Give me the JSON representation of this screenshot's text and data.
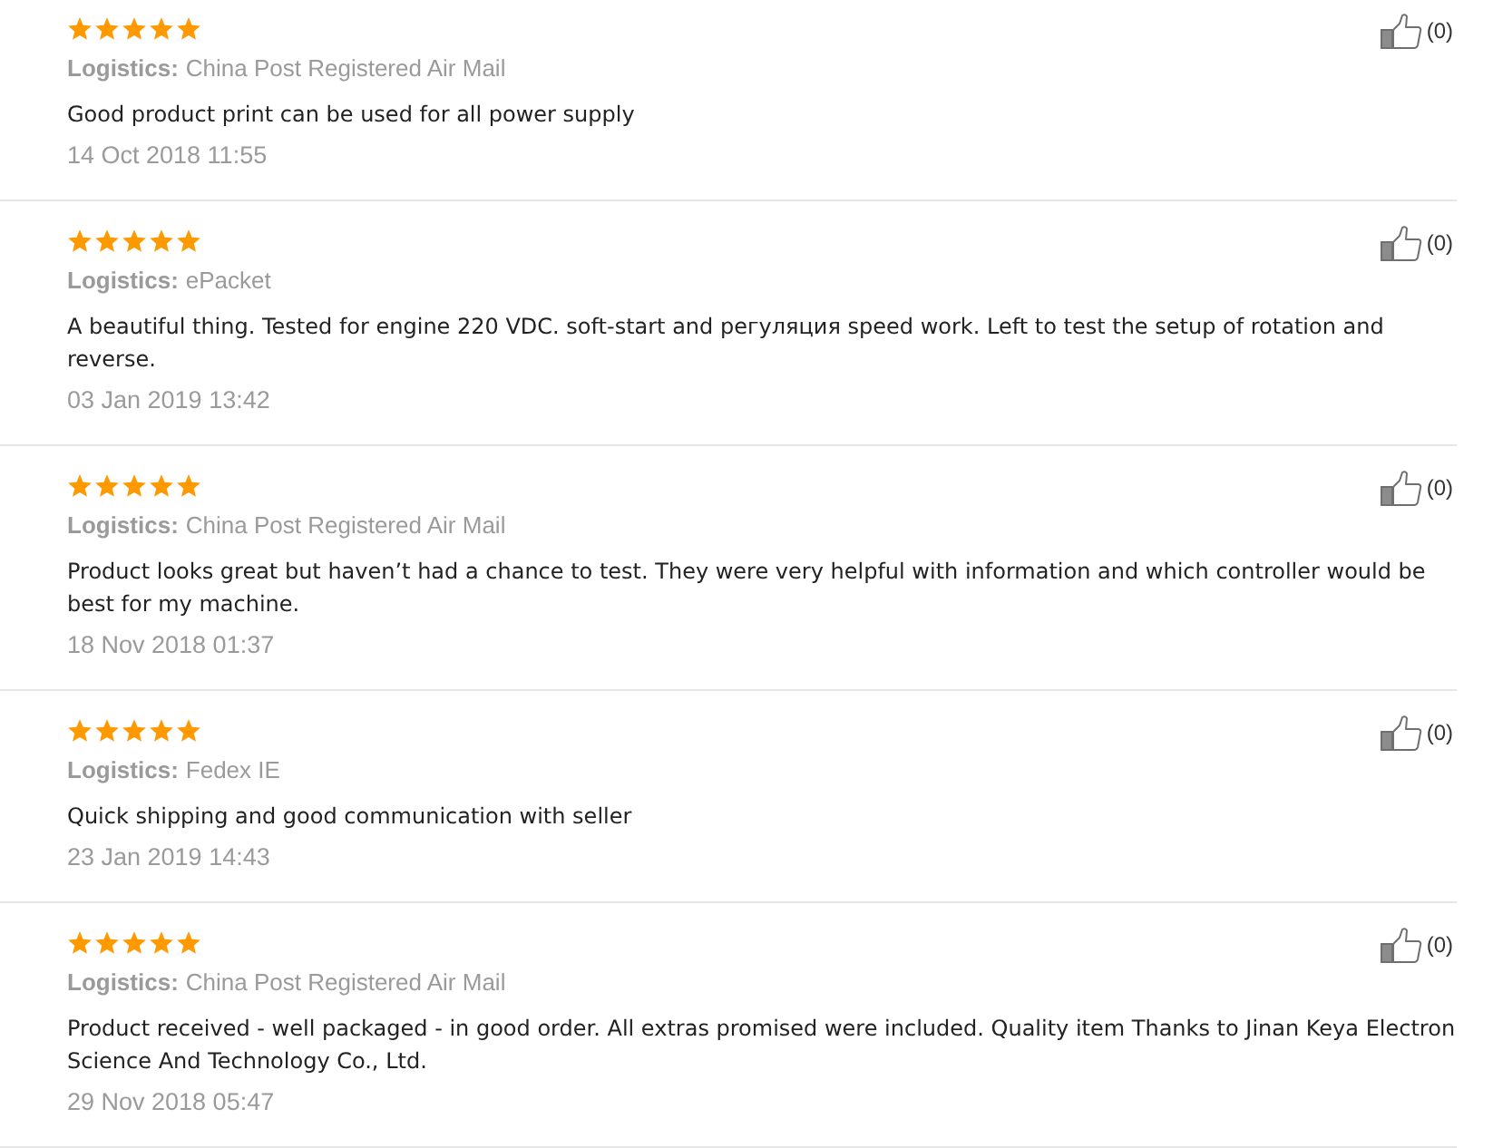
{
  "reviews": [
    {
      "stars": 5,
      "logistics_label": "Logistics:",
      "logistics": "China Post Registered Air Mail",
      "text": "Good product print can be used for all power supply",
      "date": "14 Oct 2018 11:55",
      "helpful_count": "(0)"
    },
    {
      "stars": 5,
      "logistics_label": "Logistics:",
      "logistics": "ePacket",
      "text": "A beautiful thing. Tested for engine 220 VDC. soft-start and регуляция speed work. Left to test the setup of rotation and reverse.",
      "date": "03 Jan 2019 13:42",
      "helpful_count": "(0)"
    },
    {
      "stars": 5,
      "logistics_label": "Logistics:",
      "logistics": "China Post Registered Air Mail",
      "text": "Product looks great but haven’t had a chance to test. They were very helpful with information and which controller would be best for my machine.",
      "date": "18 Nov 2018 01:37",
      "helpful_count": "(0)"
    },
    {
      "stars": 5,
      "logistics_label": "Logistics:",
      "logistics": "Fedex IE",
      "text": "Quick shipping and good communication with seller",
      "date": "23 Jan 2019 14:43",
      "helpful_count": "(0)"
    },
    {
      "stars": 5,
      "logistics_label": "Logistics:",
      "logistics": "China Post Registered Air Mail",
      "text": "Product received - well packaged - in good order. All extras promised were included. Quality item Thanks to Jinan Keya Electron Science And Technology Co., Ltd.",
      "date": "29 Nov 2018 05:47",
      "helpful_count": "(0)"
    }
  ]
}
